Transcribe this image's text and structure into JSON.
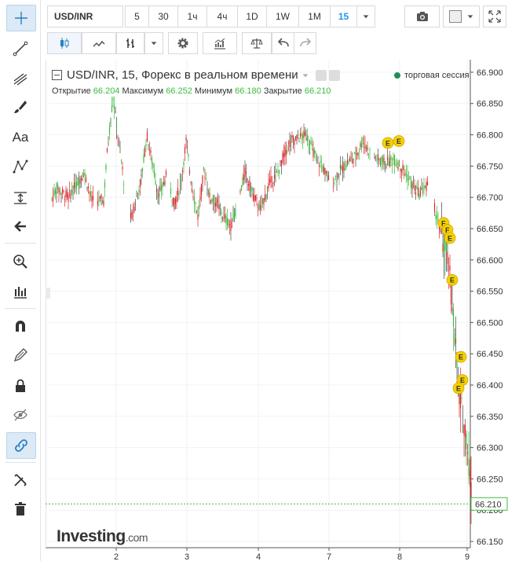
{
  "toolbar": {
    "symbol": "USD/INR",
    "timeframes": [
      "5",
      "30",
      "1ч",
      "4ч",
      "1D",
      "1W",
      "1M",
      "15"
    ],
    "active_timeframe": "15"
  },
  "left_tools": [
    {
      "name": "crosshair-icon"
    },
    {
      "name": "trend-line-icon"
    },
    {
      "name": "pitchfork-icon"
    },
    {
      "name": "brush-icon"
    },
    {
      "name": "text-icon",
      "label": "Aa"
    },
    {
      "name": "pattern-icon"
    },
    {
      "name": "measure-icon"
    },
    {
      "name": "arrow-left-icon"
    },
    {
      "name": "zoom-icon"
    },
    {
      "name": "indicators-icon"
    },
    {
      "name": "magnet-icon"
    },
    {
      "name": "pencil-icon"
    },
    {
      "name": "lock-icon"
    },
    {
      "name": "eye-hidden-icon"
    },
    {
      "name": "link-icon"
    },
    {
      "name": "settings-tools-icon"
    },
    {
      "name": "trash-icon"
    }
  ],
  "legend": {
    "title": "USD/INR, 15, Форекс в реальном времени",
    "open_label": "Открытие",
    "open": "66.204",
    "high_label": "Максимум",
    "high": "66.252",
    "low_label": "Минимум",
    "low": "66.180",
    "close_label": "Закрытие",
    "close": "66.210",
    "session": "торговая сессия"
  },
  "logo": {
    "main": "Investing",
    "suffix": ".com"
  },
  "colors": {
    "up": "#3cbc3c",
    "down": "#e0262b",
    "accent": "#2196f3",
    "event": "#f5d100"
  },
  "chart_data": {
    "type": "candlestick",
    "title": "USD/INR, 15, Форекс в реальном времени",
    "yticks": [
      "66.900",
      "66.850",
      "66.800",
      "66.750",
      "66.700",
      "66.650",
      "66.600",
      "66.550",
      "66.500",
      "66.450",
      "66.400",
      "66.350",
      "66.300",
      "66.250",
      "66.200",
      "66.150"
    ],
    "ylim": [
      66.14,
      66.92
    ],
    "xticks": [
      "2",
      "3",
      "4",
      "7",
      "8",
      "9"
    ],
    "last_price": "66.210",
    "profile": [
      [
        0,
        66.685
      ],
      [
        10,
        66.715
      ],
      [
        25,
        66.7
      ],
      [
        45,
        66.74
      ],
      [
        55,
        66.695
      ],
      [
        70,
        66.695
      ],
      [
        75,
        66.78
      ],
      [
        82,
        66.86
      ],
      [
        88,
        66.8
      ],
      [
        95,
        66.735
      ],
      [
        100,
        66.66
      ],
      [
        106,
        66.67
      ],
      [
        112,
        66.7
      ],
      [
        118,
        66.73
      ],
      [
        125,
        66.8
      ],
      [
        132,
        66.755
      ],
      [
        140,
        66.7
      ],
      [
        150,
        66.735
      ],
      [
        160,
        66.69
      ],
      [
        168,
        66.72
      ],
      [
        175,
        66.79
      ],
      [
        182,
        66.72
      ],
      [
        190,
        66.67
      ],
      [
        198,
        66.745
      ],
      [
        205,
        66.7
      ],
      [
        215,
        66.69
      ],
      [
        222,
        66.67
      ],
      [
        232,
        66.655
      ],
      [
        240,
        66.685
      ],
      [
        250,
        66.74
      ],
      [
        260,
        66.705
      ],
      [
        270,
        66.68
      ],
      [
        280,
        66.72
      ],
      [
        292,
        66.74
      ],
      [
        300,
        66.77
      ],
      [
        308,
        66.79
      ],
      [
        318,
        66.795
      ],
      [
        328,
        66.8
      ],
      [
        338,
        66.77
      ],
      [
        350,
        66.745
      ],
      [
        360,
        66.72
      ],
      [
        370,
        66.74
      ],
      [
        380,
        66.755
      ],
      [
        390,
        66.765
      ],
      [
        400,
        66.79
      ],
      [
        410,
        66.77
      ],
      [
        420,
        66.76
      ],
      [
        430,
        66.755
      ],
      [
        440,
        66.76
      ],
      [
        452,
        66.745
      ],
      [
        462,
        66.72
      ],
      [
        472,
        66.705
      ],
      [
        482,
        66.72
      ],
      [
        492,
        66.68
      ],
      [
        498,
        66.65
      ],
      [
        504,
        66.62
      ],
      [
        510,
        66.58
      ],
      [
        514,
        66.53
      ],
      [
        518,
        66.47
      ],
      [
        522,
        66.39
      ],
      [
        527,
        66.35
      ],
      [
        532,
        66.32
      ],
      [
        536,
        66.26
      ],
      [
        540,
        66.21
      ]
    ],
    "events": [
      {
        "label": "E",
        "x": 432,
        "y": 66.787
      },
      {
        "label": "E",
        "x": 446,
        "y": 66.79
      },
      {
        "label": "F",
        "x": 503,
        "y": 66.659
      },
      {
        "label": "F",
        "x": 508,
        "y": 66.648
      },
      {
        "label": "E",
        "x": 511,
        "y": 66.635
      },
      {
        "label": "E",
        "x": 514,
        "y": 66.568
      },
      {
        "label": "E",
        "x": 525,
        "y": 66.445
      },
      {
        "label": "E",
        "x": 527,
        "y": 66.408
      },
      {
        "label": "E",
        "x": 522,
        "y": 66.395
      }
    ]
  }
}
